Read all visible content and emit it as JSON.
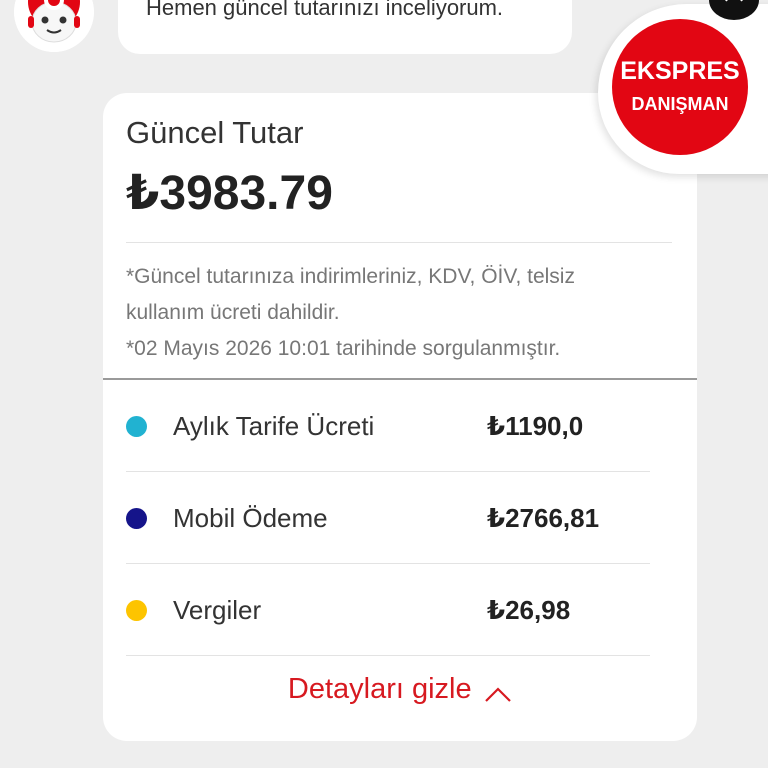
{
  "chat": {
    "message": "Hemen güncel tutarınızı inceliyorum.",
    "avatar_icon": "robot-mascot-icon"
  },
  "express_advisor": {
    "line1": "EKSPRES",
    "line2": "DANIŞMAN",
    "color": "#e20613"
  },
  "close_icon": "close-icon",
  "bill": {
    "title": "Güncel Tutar",
    "amount": "₺3983.79",
    "notes": [
      "*Güncel tutarınıza indirimleriniz, KDV, ÖİV, telsiz",
      "kullanım ücreti dahildir.",
      "*02 Mayıs 2026 10:01 tarihinde sorgulanmıştır."
    ],
    "items": [
      {
        "label": "Aylık Tarife Ücreti",
        "value": "₺1190,0",
        "color": "#21b2d1"
      },
      {
        "label": "Mobil Ödeme",
        "value": "₺2766,81",
        "color": "#15148a"
      },
      {
        "label": "Vergiler",
        "value": "₺26,98",
        "color": "#fdc400"
      }
    ],
    "toggle_label": "Detayları gizle",
    "toggle_icon": "chevron-up-icon",
    "accent": "#d71920"
  }
}
